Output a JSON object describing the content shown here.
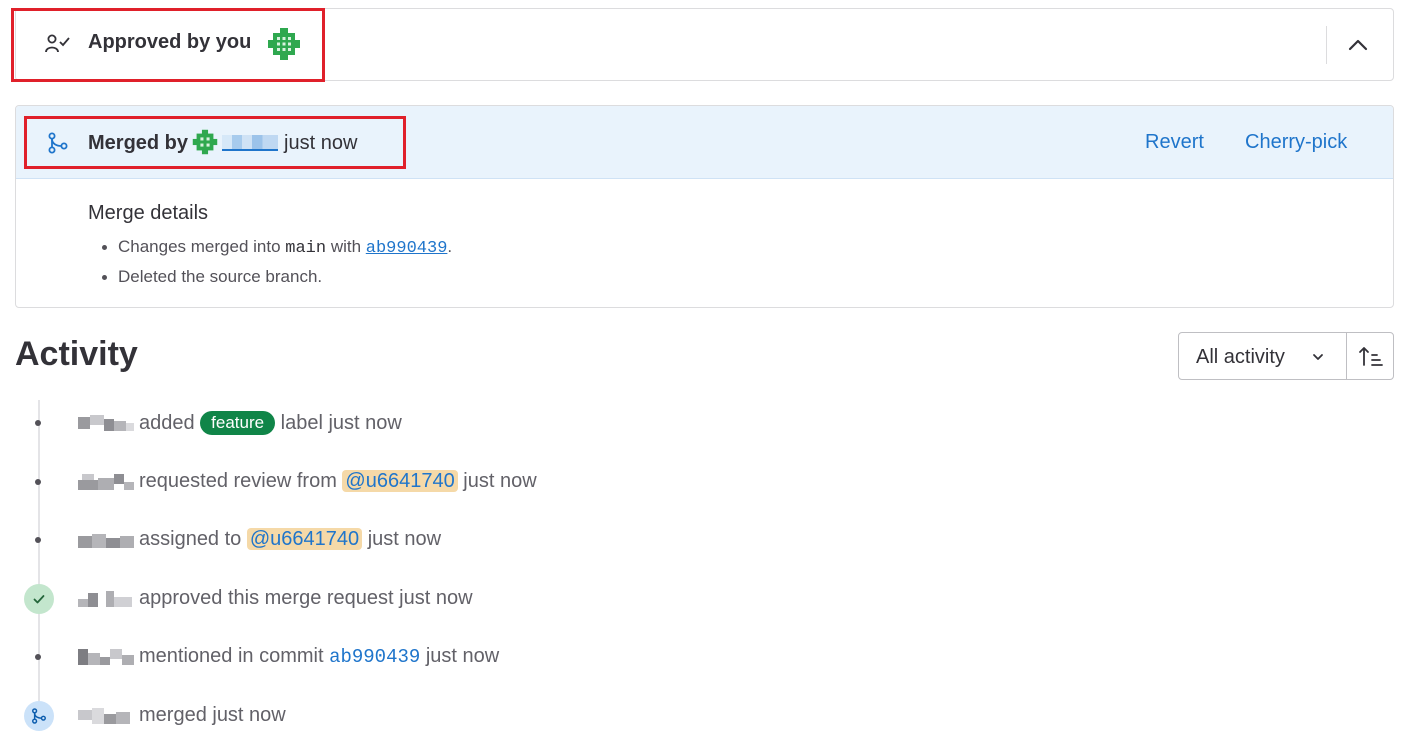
{
  "approval": {
    "text": "Approved by you"
  },
  "merge": {
    "merged_by_label": "Merged by",
    "time": "just now",
    "revert_label": "Revert",
    "cherry_pick_label": "Cherry-pick",
    "details_title": "Merge details",
    "detail_1_prefix": "Changes merged into ",
    "branch": "main",
    "detail_1_with": " with ",
    "commit_sha": "ab990439",
    "detail_1_suffix": ".",
    "detail_2": "Deleted the source branch."
  },
  "activity": {
    "title": "Activity",
    "filter_label": "All activity",
    "events": [
      {
        "pre": "added ",
        "label": "feature",
        "post": " label just now"
      },
      {
        "pre": "requested review from ",
        "mention": "@u6641740",
        "post": " just now"
      },
      {
        "pre": "assigned to ",
        "mention": "@u6641740",
        "post": " just now"
      },
      {
        "text": "approved this merge request just now"
      },
      {
        "pre": "mentioned in commit ",
        "commit": "ab990439",
        "post": " just now"
      },
      {
        "text": "merged just now"
      }
    ]
  },
  "colors": {
    "link": "#1f75cb",
    "highlight": "#e0202a",
    "merge_header_bg": "#e9f3fc",
    "label_feature": "#108548",
    "mention_bg": "#f5d9a8",
    "approved_circle": "#c3e6cd",
    "merged_circle": "#cbe2f9"
  },
  "icons": {
    "approval": "user-check-icon",
    "collapse": "chevron-up-icon",
    "merge": "merge-icon",
    "filter_chevron": "chevron-down-icon",
    "sort": "sort-ascending-icon",
    "approved": "check-icon"
  }
}
